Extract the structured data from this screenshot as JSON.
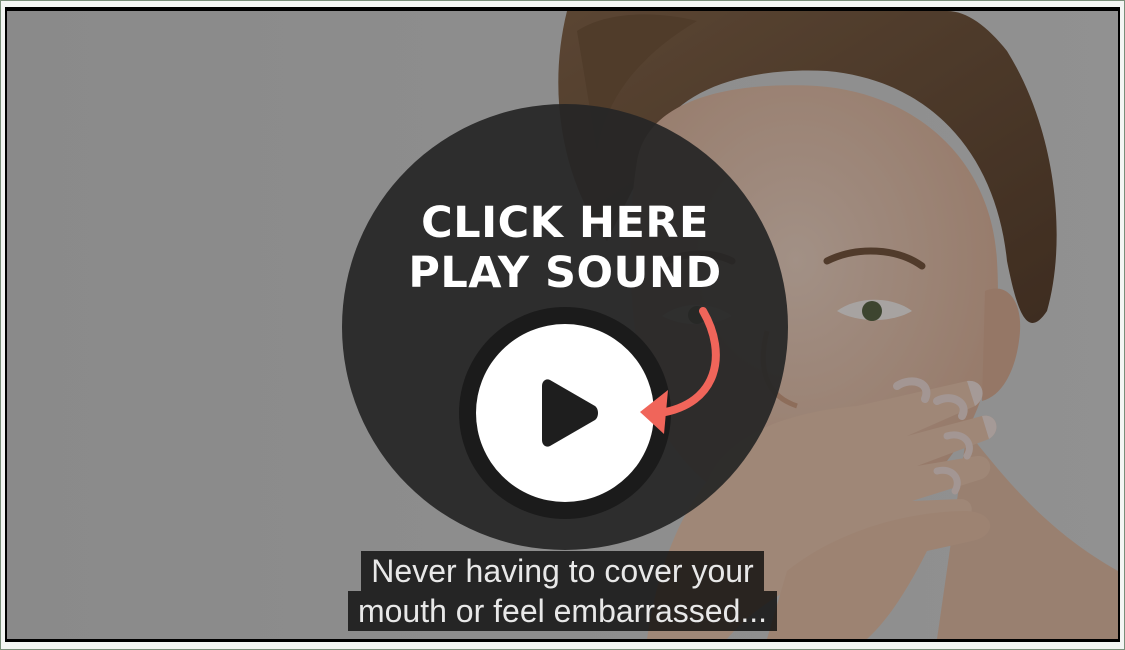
{
  "cta": {
    "line1": "CLICK HERE",
    "line2": "PLAY SOUND",
    "play_icon": "play-icon",
    "arrow_icon": "curved-arrow-icon",
    "arrow_color": "#f0655a"
  },
  "caption": {
    "line1": "Never having to cover your",
    "line2": "mouth or feel embarrassed..."
  }
}
